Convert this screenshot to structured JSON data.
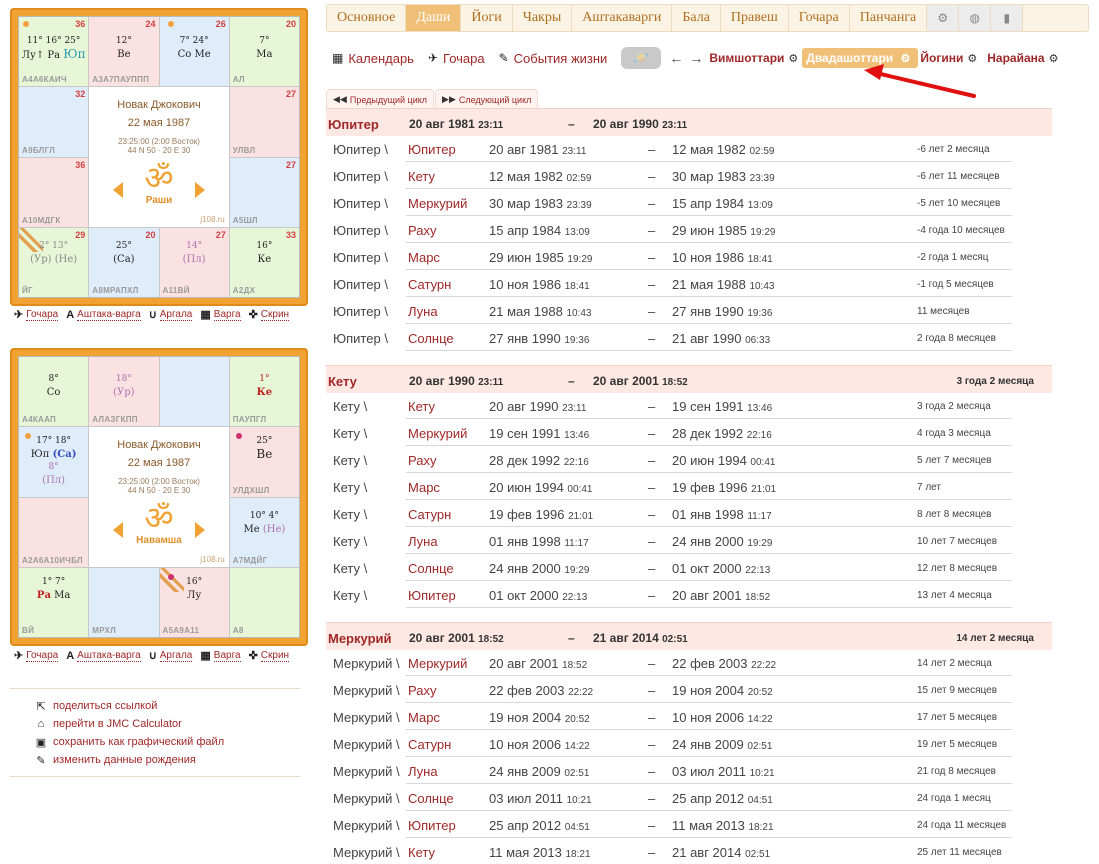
{
  "tabs": [
    "Основное",
    "Даши",
    "Йоги",
    "Чакры",
    "Аштакаварги",
    "Бала",
    "Правеш",
    "Гочара",
    "Панчанга"
  ],
  "active_tab": 1,
  "tab_icons": [
    "gear-icon",
    "globe-icon",
    "book-icon"
  ],
  "subnav": {
    "calendar": "Календарь",
    "gochara": "Гочара",
    "events": "События жизни",
    "vimshottari": "Вимшоттари",
    "dvadashottari": "Двадашоттари",
    "yogini": "Йогини",
    "narayana": "Нарайана"
  },
  "cycle_tabs": {
    "prev": "Предыдущий цикл",
    "next": "Следующий цикл"
  },
  "chart1": {
    "name": "Новак Джокович",
    "date": "22 мая 1987",
    "time": "23:25:00 (2:00 Восток)",
    "coords": "44 N 50 · 20 E 30",
    "title": "Раши",
    "site": "j108.ru",
    "cells": {
      "c0": {
        "num": "36",
        "lbl": "А4А6КАИЧ",
        "l1": "11° 16° 25°",
        "l2a": "Лу",
        "l2b": "Ра",
        "l2c": "Юп"
      },
      "c1": {
        "num": "24",
        "lbl": "А3А7ПАУППП",
        "l1": "12°",
        "l2": "Ве"
      },
      "c2": {
        "num": "26",
        "lbl": "",
        "l1": "7° 24°",
        "l2": "Со Ме"
      },
      "c3": {
        "num": "20",
        "lbl": "АЛ",
        "l1": "7°",
        "l2": "Ма"
      },
      "c4": {
        "num": "32",
        "lbl": "А9БЛГЛ"
      },
      "c7": {
        "num": "27",
        "lbl": "УЛВЛ"
      },
      "c8": {
        "num": "36",
        "lbl": "А10МДГК"
      },
      "c11": {
        "num": "27",
        "lbl": "А5ШЛ"
      },
      "c12": {
        "num": "29",
        "lbl": "ЙГ",
        "l1": "2° 13°",
        "l2": "(Ур) (Не)"
      },
      "c13": {
        "num": "20",
        "lbl": "А8МРАПХЛ",
        "l1": "25°",
        "l2": "(Са)"
      },
      "c14": {
        "num": "27",
        "lbl": "А11ВЙ",
        "l1": "14°",
        "l2": "(Пл)"
      },
      "c15": {
        "num": "33",
        "lbl": "А2ДХ",
        "l1": "16°",
        "l2": "Ке"
      }
    }
  },
  "chart2": {
    "name": "Новак Джокович",
    "date": "22 мая 1987",
    "time": "23:25:00 (2:00 Восток)",
    "coords": "44 N 50 · 20 E 30",
    "title": "Навамша",
    "site": "j108.ru",
    "cells": {
      "c0": {
        "lbl": "А4КААП",
        "l1": "8°",
        "l2": "Со"
      },
      "c1": {
        "lbl": "АЛАЗГКПП",
        "l1": "18°",
        "l2": "(Ур)"
      },
      "c2": {
        "lbl": ""
      },
      "c3": {
        "lbl": "ПАУПГЛ",
        "l1": "1°",
        "l2": "Ке"
      },
      "c4": {
        "lbl": "",
        "l1": "17° 18°",
        "l2a": "Юп",
        "l2b": "(Са)",
        "l3": "8°",
        "l4": "(Пл)"
      },
      "c7": {
        "lbl": "УЛДХШЛ",
        "l1": "25°",
        "l2": "Ве"
      },
      "c8": {
        "lbl": "А2А6А10ИЧБЛ"
      },
      "c11": {
        "lbl": "А7МДЙГ",
        "l1": "10° 4°",
        "l2a": "Ме",
        "l2b": "(Не)"
      },
      "c12": {
        "lbl": "ВЙ",
        "l1": "1° 7°",
        "l2a": "Ра",
        "l2b": "Ма"
      },
      "c13": {
        "lbl": "МРХЛ"
      },
      "c14": {
        "lbl": "А5А9А11",
        "l1": "16°",
        "l2": "Лу"
      },
      "c15": {
        "lbl": "А8"
      }
    }
  },
  "chart_tools": [
    "Гочара",
    "Аштака-варга",
    "Аргала",
    "Варга",
    "Скрин"
  ],
  "side_links": [
    "поделиться ссылкой",
    "перейти в JMC Calculator",
    "сохранить как графический файл",
    "изменить данные рождения"
  ],
  "periods": [
    {
      "name": "Юпитер",
      "start": "20 авг 1981",
      "start_t": "23:11",
      "end": "20 авг 1990",
      "end_t": "23:11",
      "duration": "",
      "rows": [
        {
          "main": "Юпитер \\",
          "sub": "Юпитер",
          "start": "20 авг 1981",
          "st": "23:11",
          "end": "12 мая 1982",
          "et": "02:59",
          "dur": "-6 лет 2 месяца"
        },
        {
          "main": "Юпитер \\",
          "sub": "Кету",
          "start": "12 мая 1982",
          "st": "02:59",
          "end": "30 мар 1983",
          "et": "23:39",
          "dur": "-6 лет 11 месяцев"
        },
        {
          "main": "Юпитер \\",
          "sub": "Меркурий",
          "start": "30 мар 1983",
          "st": "23:39",
          "end": "15 апр 1984",
          "et": "13:09",
          "dur": "-5 лет 10 месяцев"
        },
        {
          "main": "Юпитер \\",
          "sub": "Раху",
          "start": "15 апр 1984",
          "st": "13:09",
          "end": "29 июн 1985",
          "et": "19:29",
          "dur": "-4 года 10 месяцев"
        },
        {
          "main": "Юпитер \\",
          "sub": "Марс",
          "start": "29 июн 1985",
          "st": "19:29",
          "end": "10 ноя 1986",
          "et": "18:41",
          "dur": "-2 года 1 месяц"
        },
        {
          "main": "Юпитер \\",
          "sub": "Сатурн",
          "start": "10 ноя 1986",
          "st": "18:41",
          "end": "21 мая 1988",
          "et": "10:43",
          "dur": "-1 год 5 месяцев"
        },
        {
          "main": "Юпитер \\",
          "sub": "Луна",
          "start": "21 мая 1988",
          "st": "10:43",
          "end": "27 янв 1990",
          "et": "19:36",
          "dur": "11 месяцев"
        },
        {
          "main": "Юпитер \\",
          "sub": "Солнце",
          "start": "27 янв 1990",
          "st": "19:36",
          "end": "21 авг 1990",
          "et": "06:33",
          "dur": "2 года 8 месяцев"
        }
      ]
    },
    {
      "name": "Кету",
      "start": "20 авг 1990",
      "start_t": "23:11",
      "end": "20 авг 2001",
      "end_t": "18:52",
      "duration": "3 года 2 месяца",
      "rows": [
        {
          "main": "Кету \\",
          "sub": "Кету",
          "start": "20 авг 1990",
          "st": "23:11",
          "end": "19 сен 1991",
          "et": "13:46",
          "dur": "3 года 2 месяца"
        },
        {
          "main": "Кету \\",
          "sub": "Меркурий",
          "start": "19 сен 1991",
          "st": "13:46",
          "end": "28 дек 1992",
          "et": "22:16",
          "dur": "4 года 3 месяца"
        },
        {
          "main": "Кету \\",
          "sub": "Раху",
          "start": "28 дек 1992",
          "st": "22:16",
          "end": "20 июн 1994",
          "et": "00:41",
          "dur": "5 лет 7 месяцев"
        },
        {
          "main": "Кету \\",
          "sub": "Марс",
          "start": "20 июн 1994",
          "st": "00:41",
          "end": "19 фев 1996",
          "et": "21:01",
          "dur": "7 лет"
        },
        {
          "main": "Кету \\",
          "sub": "Сатурн",
          "start": "19 фев 1996",
          "st": "21:01",
          "end": "01 янв 1998",
          "et": "11:17",
          "dur": "8 лет 8 месяцев"
        },
        {
          "main": "Кету \\",
          "sub": "Луна",
          "start": "01 янв 1998",
          "st": "11:17",
          "end": "24 янв 2000",
          "et": "19:29",
          "dur": "10 лет 7 месяцев"
        },
        {
          "main": "Кету \\",
          "sub": "Солнце",
          "start": "24 янв 2000",
          "st": "19:29",
          "end": "01 окт 2000",
          "et": "22:13",
          "dur": "12 лет 8 месяцев"
        },
        {
          "main": "Кету \\",
          "sub": "Юпитер",
          "start": "01 окт 2000",
          "st": "22:13",
          "end": "20 авг 2001",
          "et": "18:52",
          "dur": "13 лет 4 месяца"
        }
      ]
    },
    {
      "name": "Меркурий",
      "start": "20 авг 2001",
      "start_t": "18:52",
      "end": "21 авг 2014",
      "end_t": "02:51",
      "duration": "14 лет 2 месяца",
      "rows": [
        {
          "main": "Меркурий \\",
          "sub": "Меркурий",
          "start": "20 авг 2001",
          "st": "18:52",
          "end": "22 фев 2003",
          "et": "22:22",
          "dur": "14 лет 2 месяца"
        },
        {
          "main": "Меркурий \\",
          "sub": "Раху",
          "start": "22 фев 2003",
          "st": "22:22",
          "end": "19 ноя 2004",
          "et": "20:52",
          "dur": "15 лет 9 месяцев"
        },
        {
          "main": "Меркурий \\",
          "sub": "Марс",
          "start": "19 ноя 2004",
          "st": "20:52",
          "end": "10 ноя 2006",
          "et": "14:22",
          "dur": "17 лет 5 месяцев"
        },
        {
          "main": "Меркурий \\",
          "sub": "Сатурн",
          "start": "10 ноя 2006",
          "st": "14:22",
          "end": "24 янв 2009",
          "et": "02:51",
          "dur": "19 лет 5 месяцев"
        },
        {
          "main": "Меркурий \\",
          "sub": "Луна",
          "start": "24 янв 2009",
          "st": "02:51",
          "end": "03 июл 2011",
          "et": "10:21",
          "dur": "21 год 8 месяцев"
        },
        {
          "main": "Меркурий \\",
          "sub": "Солнце",
          "start": "03 июл 2011",
          "st": "10:21",
          "end": "25 апр 2012",
          "et": "04:51",
          "dur": "24 года 1 месяц"
        },
        {
          "main": "Меркурий \\",
          "sub": "Юпитер",
          "start": "25 апр 2012",
          "st": "04:51",
          "end": "11 мая 2013",
          "et": "18:21",
          "dur": "24 года 11 месяцев"
        },
        {
          "main": "Меркурий \\",
          "sub": "Кету",
          "start": "11 мая 2013",
          "st": "18:21",
          "end": "21 авг 2014",
          "et": "02:51",
          "dur": "25 лет 11 месяцев"
        }
      ]
    }
  ],
  "colors": {
    "accent": "#f0a232",
    "link": "#a02828",
    "tab_active": "#f0c078",
    "period_header": "#fde8e4"
  }
}
